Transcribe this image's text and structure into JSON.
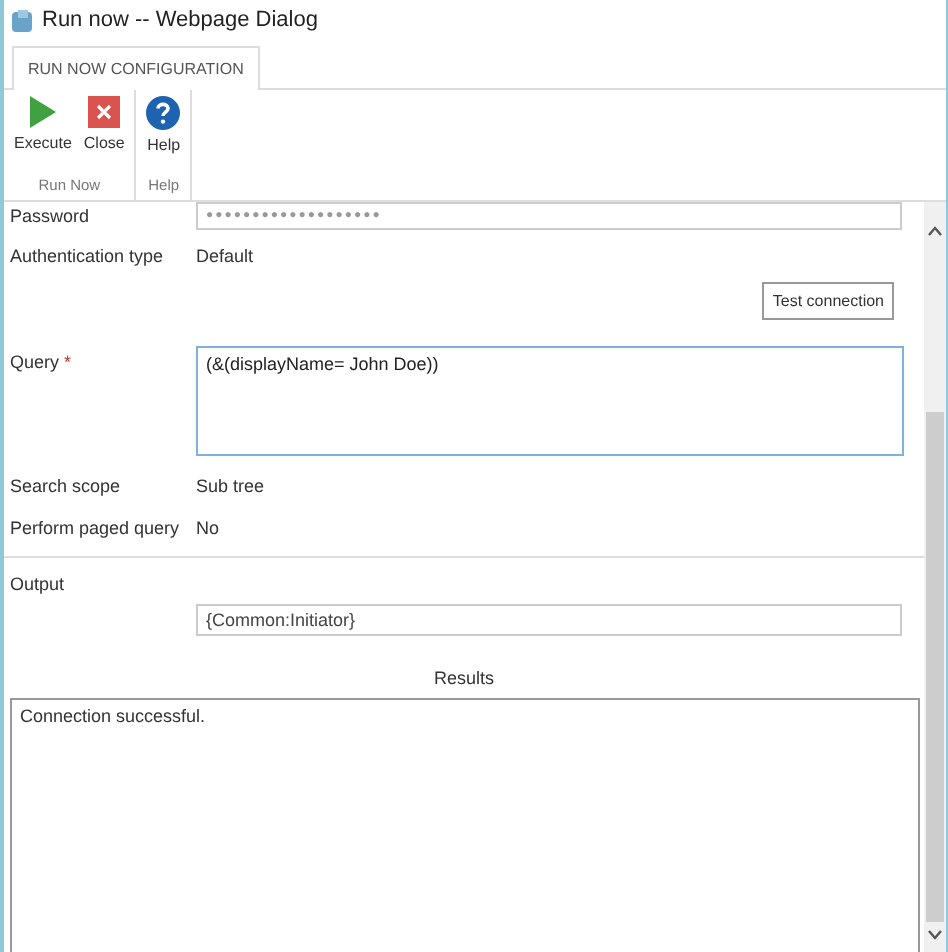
{
  "window": {
    "title": "Run now -- Webpage Dialog"
  },
  "tabs": [
    {
      "label": "RUN NOW CONFIGURATION",
      "selected": true
    }
  ],
  "ribbon": {
    "groups": [
      {
        "label": "Run Now",
        "buttons": [
          {
            "kind": "execute",
            "label": "Execute"
          },
          {
            "kind": "close",
            "label": "Close"
          }
        ]
      },
      {
        "label": "Help",
        "buttons": [
          {
            "kind": "help",
            "label": "Help"
          }
        ]
      }
    ]
  },
  "form": {
    "password": {
      "label": "Password",
      "value": "●●●●●●●●●●●●●●●●●●●"
    },
    "authentication": {
      "label": "Authentication type",
      "value": "Default"
    },
    "test_button": "Test connection",
    "query": {
      "label": "Query",
      "required_mark": "*",
      "value": "(&(displayName= John Doe))"
    },
    "search_scope": {
      "label": "Search scope",
      "value": "Sub tree"
    },
    "paged_query": {
      "label": "Perform paged query",
      "value": "No"
    },
    "output": {
      "label": "Output",
      "value": "{Common:Initiator}"
    },
    "results": {
      "label": "Results",
      "value": "Connection successful."
    }
  }
}
